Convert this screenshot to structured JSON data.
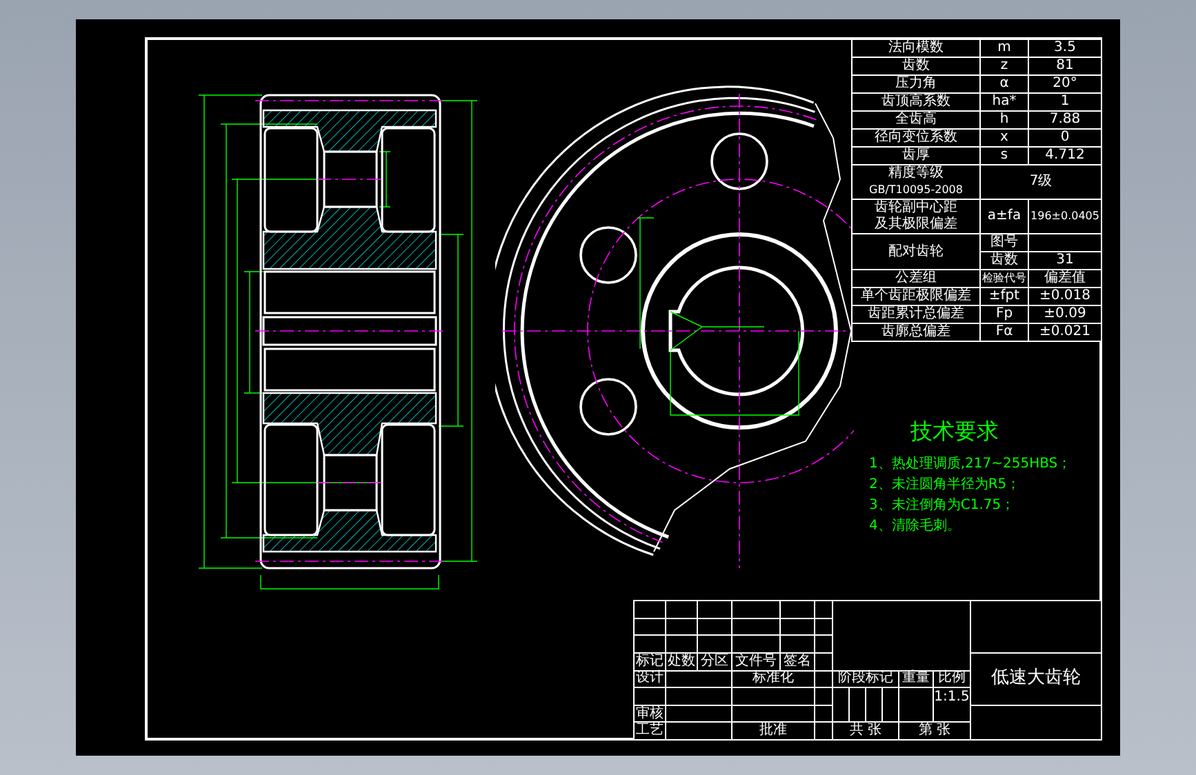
{
  "parameter_table": {
    "basic_rows": [
      {
        "name": "法向模数",
        "symbol": "m",
        "value": "3.5"
      },
      {
        "name": "齿数",
        "symbol": "z",
        "value": "81"
      },
      {
        "name": "压力角",
        "symbol": "α",
        "value": "20°"
      },
      {
        "name": "齿顶高系数",
        "symbol": "ha*",
        "value": "1"
      },
      {
        "name": "全齿高",
        "symbol": "h",
        "value": "7.88"
      },
      {
        "name": "径向变位系数",
        "symbol": "x",
        "value": "0"
      },
      {
        "name": "齿厚",
        "symbol": "s",
        "value": "4.712"
      }
    ],
    "precision": {
      "name": "精度等级",
      "standard": "GB/T10095-2008",
      "value": "7级"
    },
    "center_distance": {
      "name_lines": [
        "齿轮副中心距",
        "及其极限偏差"
      ],
      "symbol": "a±fa",
      "value": "196±0.0405"
    },
    "mating_gear": {
      "name": "配对齿轮",
      "drawing_no_label": "图号",
      "teeth_label": "齿数",
      "teeth": "31"
    },
    "tolerance_header": {
      "name": "公差组",
      "code_label": "检验代号",
      "value_label": "偏差值"
    },
    "tolerance_rows": [
      {
        "name": "单个齿距极限偏差",
        "symbol": "±fpt",
        "value": "±0.018"
      },
      {
        "name": "齿距累计总偏差",
        "symbol": "Fp",
        "value": "±0.09"
      },
      {
        "name": "齿廓总偏差",
        "symbol": "Fα",
        "value": "±0.021"
      }
    ]
  },
  "technical_requirements": {
    "title": "技术要求",
    "items": [
      "1、热处理调质,217~255HBS；",
      "2、未注圆角半径为R5；",
      "3、未注倒角为C1.75；",
      "4、清除毛刺。"
    ]
  },
  "title_block": {
    "revision_headers": [
      "标记",
      "处数",
      "分区",
      "文件号",
      "签名"
    ],
    "designer_label": "设计",
    "standardization_label": "标准化",
    "reviewer_label": "审核",
    "process_label": "工艺",
    "approval_label": "批准",
    "stage_label": "阶段标记",
    "weight_label": "重量",
    "scale_label": "比例",
    "scale": "1:1.5",
    "sheet_total": "共 张",
    "sheet_number": "第 张",
    "drawing_name": "低速大齿轮"
  }
}
